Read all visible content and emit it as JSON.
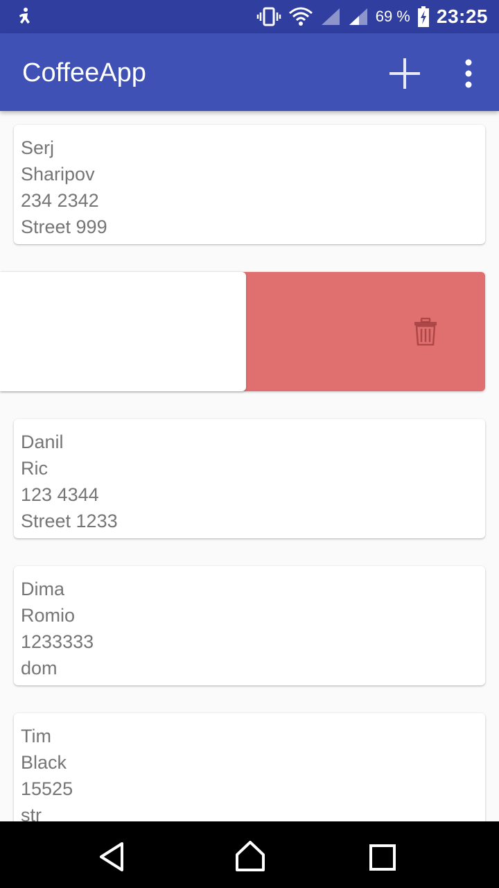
{
  "status_bar": {
    "battery_percent": "69 %",
    "time": "23:25",
    "icons": [
      "notification-icon",
      "vibrate-icon",
      "wifi-icon",
      "signal-icon",
      "signal-icon",
      "battery-charging-icon"
    ]
  },
  "app_bar": {
    "title": "CoffeeApp",
    "actions": [
      "add-icon",
      "more-vert-icon"
    ]
  },
  "colors": {
    "status_bar": "#303f9f",
    "app_bar": "#3f51b5",
    "swipe_delete": "#e06f6f",
    "text": "#757575"
  },
  "contacts": [
    {
      "first_name": "Serj",
      "last_name": "Sharipov",
      "phone": "234 2342",
      "address": "Street 999"
    },
    {
      "first_name": "Danil",
      "last_name": "Ric",
      "phone": "123 4344",
      "address": "Street 1233"
    },
    {
      "first_name": "Dima",
      "last_name": "Romio",
      "phone": "1233333",
      "address": "dom"
    },
    {
      "first_name": "Tim",
      "last_name": "Black",
      "phone": "15525",
      "address": "str"
    }
  ],
  "swiped_item": {
    "action_icon": "trash-icon"
  },
  "nav_bar": {
    "buttons": [
      "back-icon",
      "home-icon",
      "recents-icon"
    ]
  }
}
